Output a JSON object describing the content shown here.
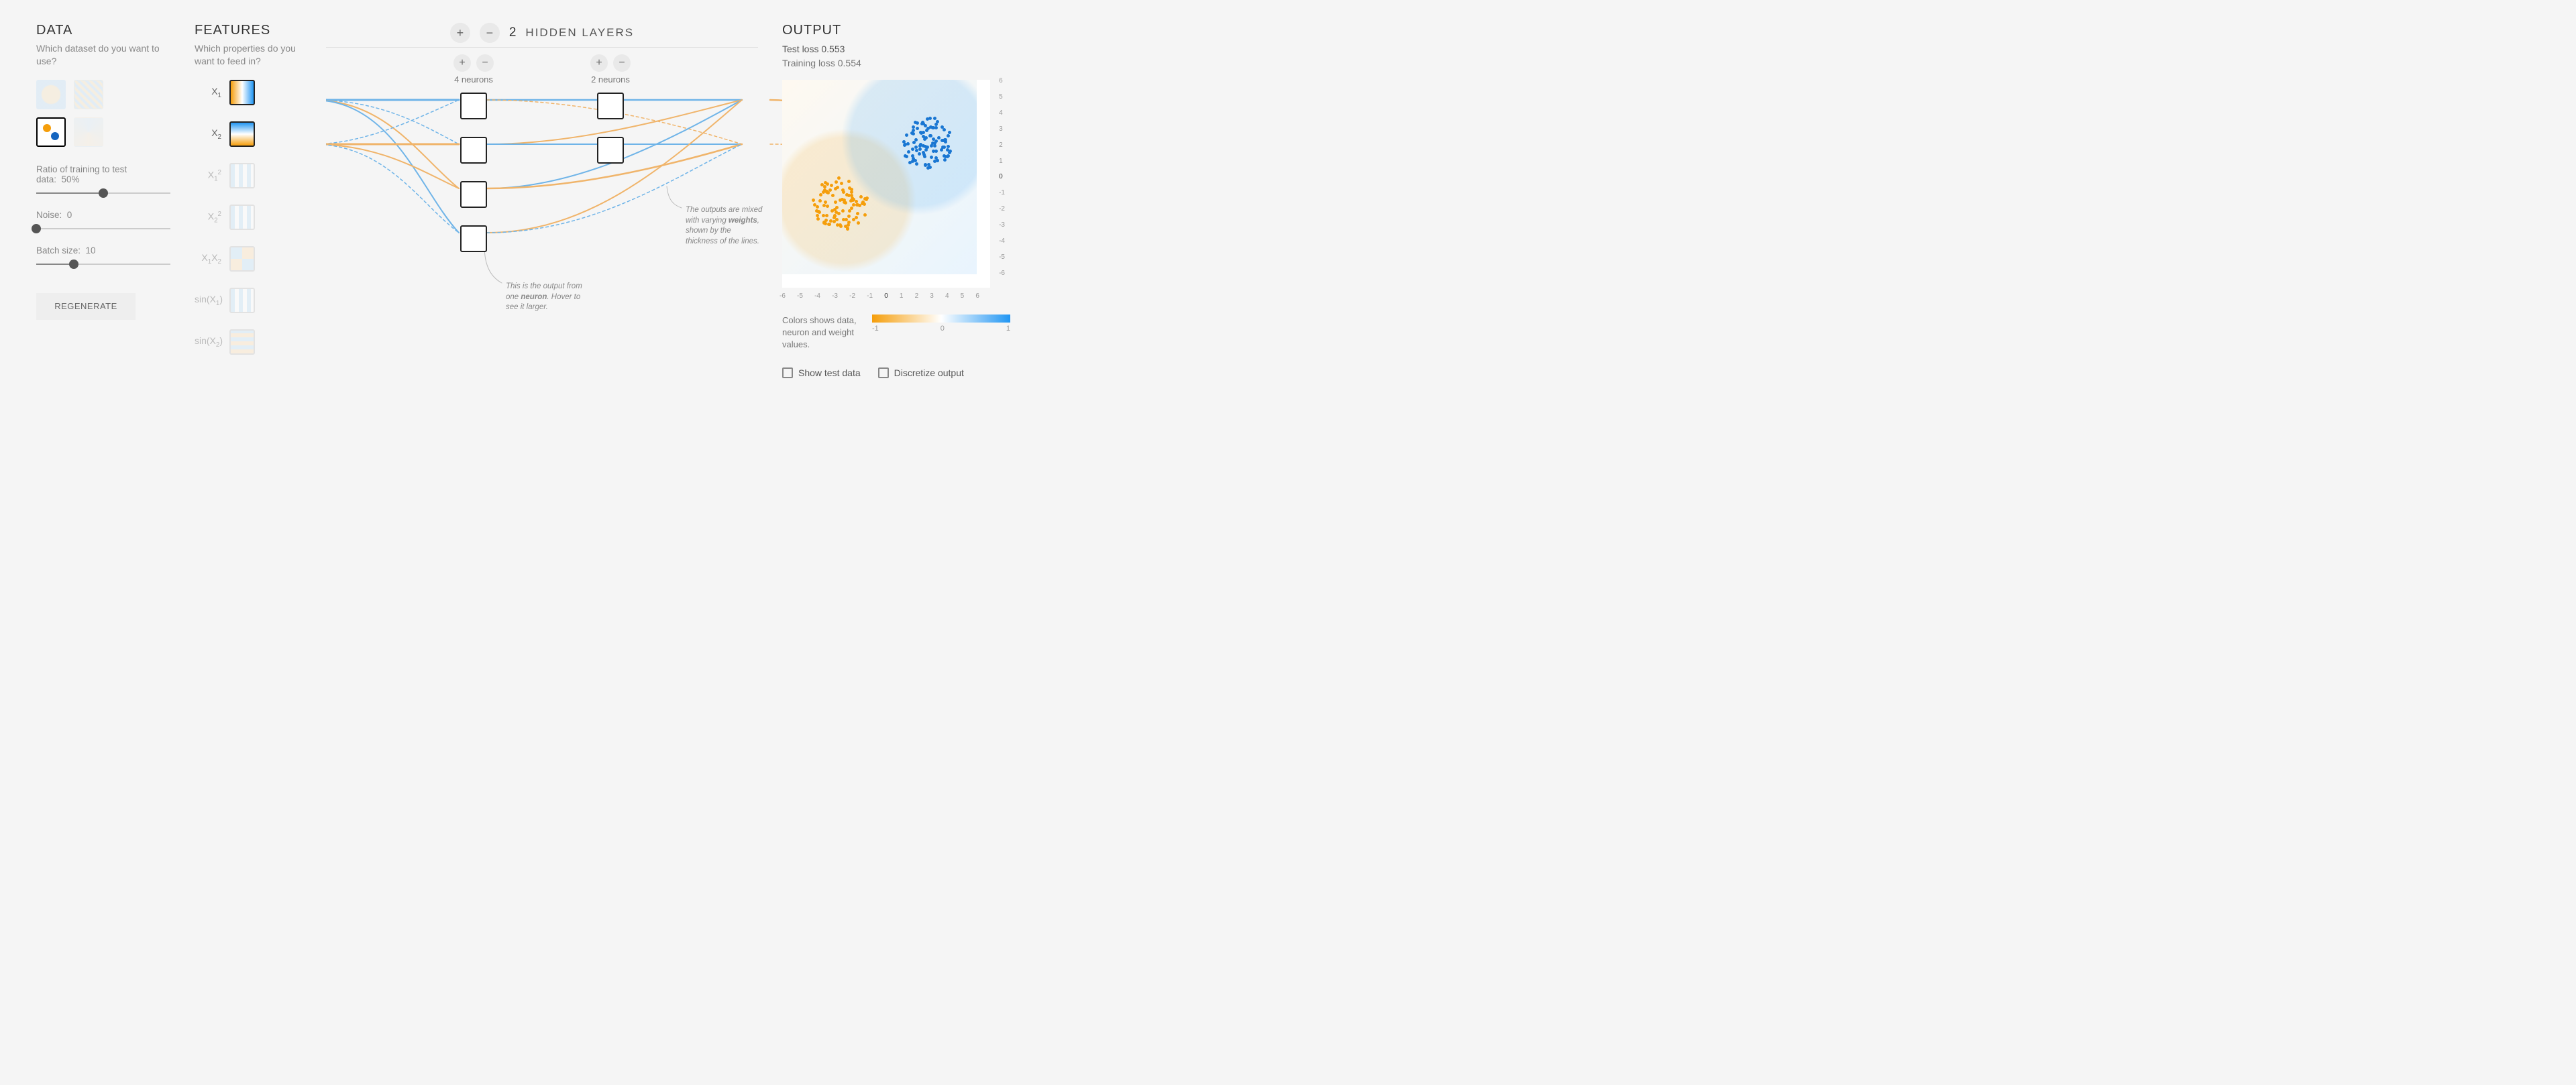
{
  "data": {
    "title": "DATA",
    "subtitle": "Which dataset do you want to use?",
    "datasets": [
      {
        "name": "circle",
        "selected": false
      },
      {
        "name": "xor",
        "selected": false
      },
      {
        "name": "gaussian",
        "selected": true
      },
      {
        "name": "spiral",
        "selected": false
      }
    ],
    "ratio": {
      "label": "Ratio of training to test data:",
      "value": "50%",
      "pct": 50
    },
    "noise": {
      "label": "Noise:",
      "value": "0",
      "pct": 0
    },
    "batch": {
      "label": "Batch size:",
      "value": "10",
      "pct": 28
    },
    "regenerate": "REGENERATE"
  },
  "features": {
    "title": "FEATURES",
    "subtitle": "Which properties do you want to feed in?",
    "items": [
      {
        "label": "X",
        "sub": "1",
        "sup": "",
        "active": true,
        "style": "grad-h"
      },
      {
        "label": "X",
        "sub": "2",
        "sup": "",
        "active": true,
        "style": "grad-v"
      },
      {
        "label": "X",
        "sub": "1",
        "sup": "2",
        "active": false,
        "style": "grad-stripe-v"
      },
      {
        "label": "X",
        "sub": "2",
        "sup": "2",
        "active": false,
        "style": "grad-stripe-v"
      },
      {
        "label": "X",
        "sub": "1",
        "sup": "",
        "label2": "X",
        "sub2": "2",
        "active": false,
        "style": "grad-xor"
      },
      {
        "label": "sin(X",
        "sub": "1",
        "sup": "",
        "label2": ")",
        "active": false,
        "style": "grad-stripe-v"
      },
      {
        "label": "sin(X",
        "sub": "2",
        "sup": "",
        "label2": ")",
        "active": false,
        "style": "grad-stripe-h"
      }
    ]
  },
  "network": {
    "count": "2",
    "label": "HIDDEN LAYERS",
    "layers": [
      {
        "neurons": 4,
        "label": "4 neurons",
        "styles": [
          "grad-d",
          "grad-v",
          "grad-d",
          "grad-d"
        ]
      },
      {
        "neurons": 2,
        "label": "2 neurons",
        "styles": [
          "grad-d",
          "grad-x"
        ]
      }
    ],
    "callout_weights_pre": "The outputs are mixed with varying ",
    "callout_weights_bold": "weights",
    "callout_weights_post": ", shown by the thickness of the lines.",
    "callout_neuron_pre": "This is the output from one ",
    "callout_neuron_bold": "neuron",
    "callout_neuron_post": ". Hover to see it larger."
  },
  "output": {
    "title": "OUTPUT",
    "test_loss_label": "Test loss ",
    "test_loss": "0.553",
    "train_loss_label": "Training loss ",
    "train_loss": "0.554",
    "axis_ticks": [
      "-6",
      "-5",
      "-4",
      "-3",
      "-2",
      "-1",
      "0",
      "1",
      "2",
      "3",
      "4",
      "5",
      "6"
    ],
    "legend_text": "Colors shows data, neuron and weight values.",
    "legend_ticks": [
      "-1",
      "0",
      "1"
    ],
    "show_test": "Show test data",
    "discretize": "Discretize output"
  },
  "colors": {
    "orange": "#f59e0b",
    "blue": "#2196f3"
  },
  "chart_data": {
    "type": "scatter",
    "title": "Output decision surface",
    "xlabel": "",
    "ylabel": "",
    "xlim": [
      -6,
      6
    ],
    "ylim": [
      -6,
      6
    ],
    "series": [
      {
        "name": "class-blue",
        "color": "#1976d2",
        "cluster_center": [
          2.8,
          2.2
        ],
        "cluster_radius": 1.6,
        "approx_points": 100
      },
      {
        "name": "class-orange",
        "color": "#f59e0b",
        "cluster_center": [
          -2.5,
          -1.6
        ],
        "cluster_radius": 1.7,
        "approx_points": 100
      }
    ],
    "colorbar": {
      "min": -1,
      "mid": 0,
      "max": 1,
      "gradient": [
        "#f59e0b",
        "#ffffff",
        "#2196f3"
      ]
    }
  }
}
